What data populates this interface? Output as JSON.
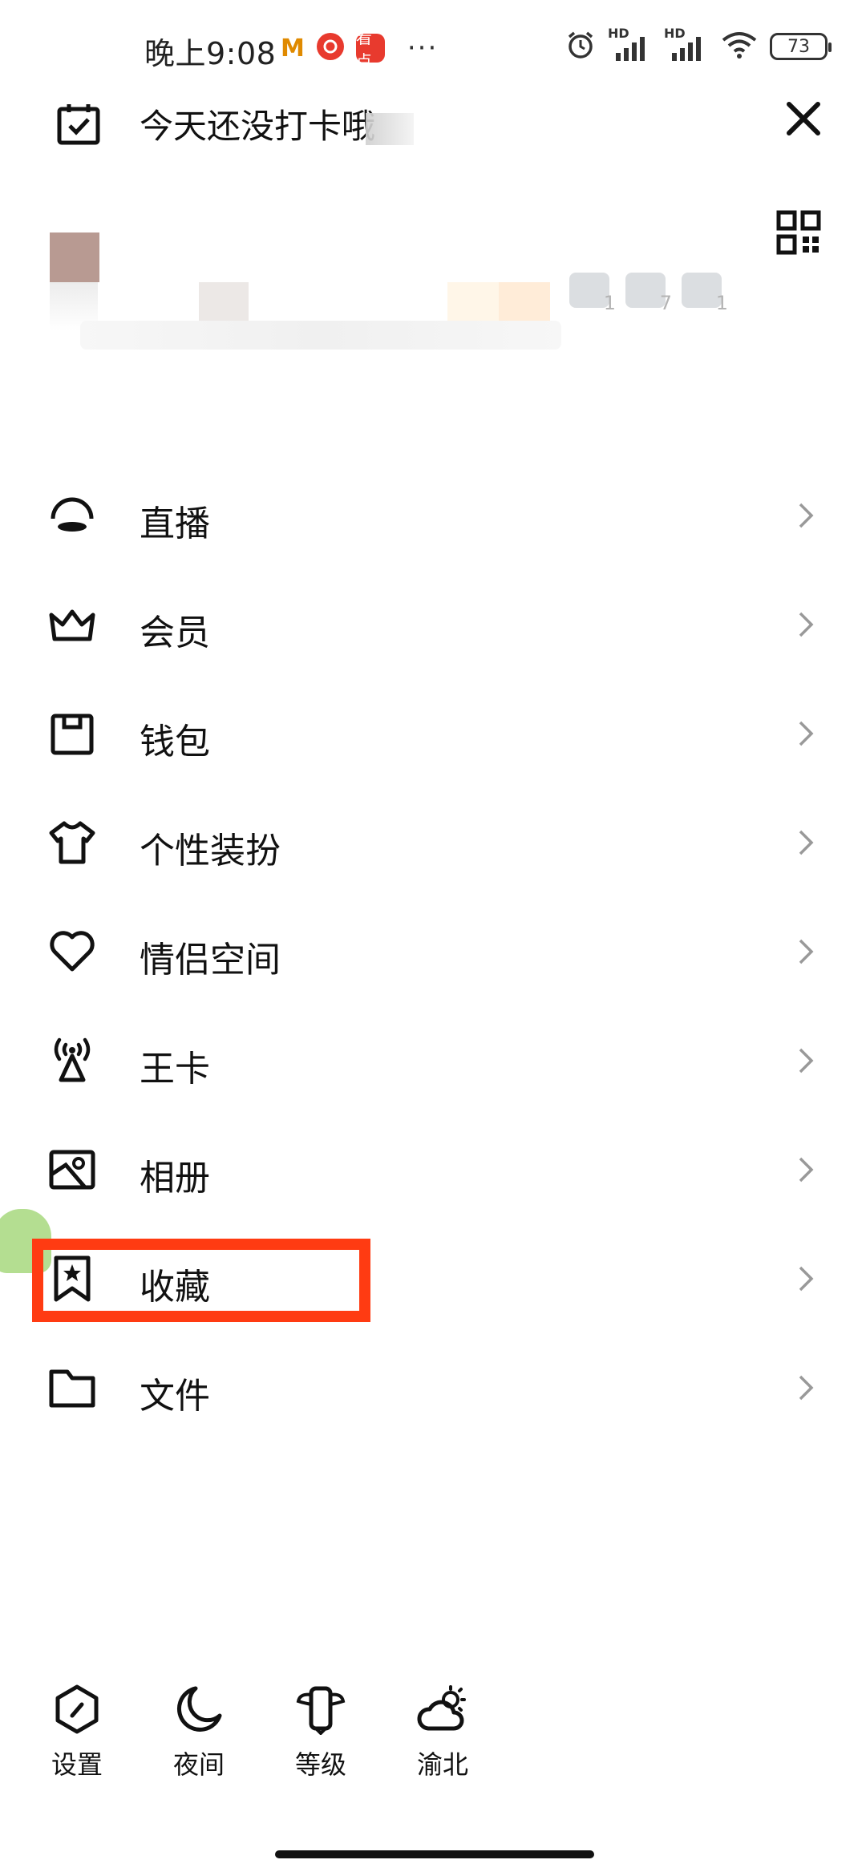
{
  "status_bar": {
    "time": "晚上9:08",
    "app_m_label": "M",
    "app_red_label": "看点",
    "more_dots": "···",
    "signal1_label": "HD",
    "signal2_label": "HD",
    "battery": "73"
  },
  "header": {
    "checkin_text": "今天还没打卡哦"
  },
  "profile": {
    "medal_counts": [
      "1",
      "7",
      "1"
    ]
  },
  "menu": {
    "items": [
      {
        "label": "直播",
        "icon": "live-icon"
      },
      {
        "label": "会员",
        "icon": "crown-icon"
      },
      {
        "label": "钱包",
        "icon": "wallet-icon"
      },
      {
        "label": "个性装扮",
        "icon": "tshirt-icon"
      },
      {
        "label": "情侣空间",
        "icon": "heart-icon"
      },
      {
        "label": "王卡",
        "icon": "signal-tower-icon"
      },
      {
        "label": "相册",
        "icon": "album-icon"
      },
      {
        "label": "收藏",
        "icon": "bookmark-star-icon"
      },
      {
        "label": "文件",
        "icon": "folder-icon"
      }
    ]
  },
  "highlight_color": "#ff3b12",
  "bottom_bar": {
    "settings": "设置",
    "night": "夜间",
    "level": "等级",
    "weather": "渝北"
  }
}
